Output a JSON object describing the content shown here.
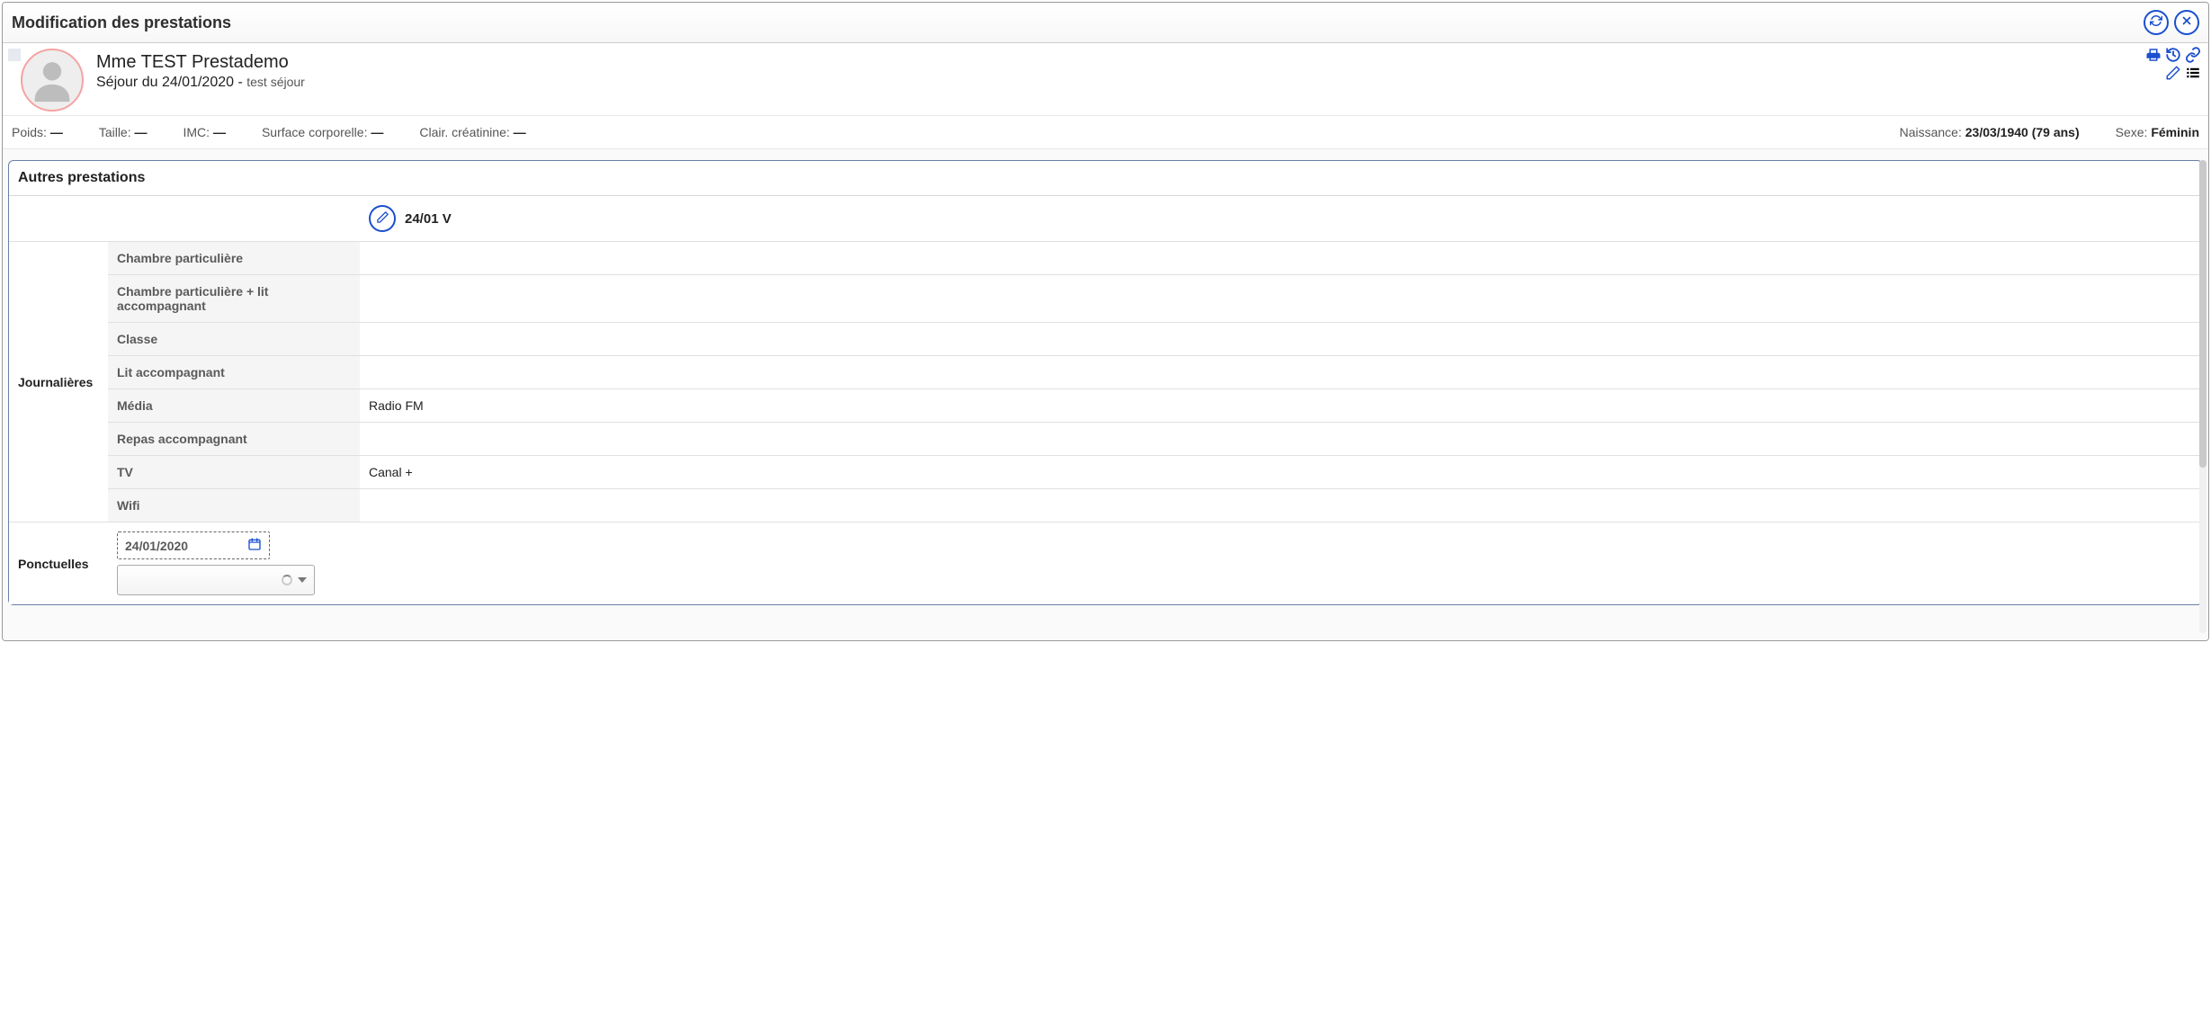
{
  "title": "Modification des prestations",
  "patient": {
    "name": "Mme TEST Prestademo",
    "stay_prefix": "Séjour du 24/01/2020 -",
    "stay_type": "test séjour"
  },
  "vitals": {
    "weight_label": "Poids:",
    "weight_value": "—",
    "height_label": "Taille:",
    "height_value": "—",
    "bmi_label": "IMC:",
    "bmi_value": "—",
    "bsa_label": "Surface corporelle:",
    "bsa_value": "—",
    "creat_label": "Clair. créatinine:",
    "creat_value": "—",
    "birth_label": "Naissance:",
    "birth_value": "23/03/1940 (79 ans)",
    "sex_label": "Sexe:",
    "sex_value": "Féminin"
  },
  "panel": {
    "title": "Autres prestations",
    "date_header": "24/01 V",
    "groups": {
      "daily_label": "Journalières",
      "punctual_label": "Ponctuelles"
    },
    "daily_rows": [
      {
        "name": "Chambre particulière",
        "value": ""
      },
      {
        "name": "Chambre particulière + lit accompagnant",
        "value": ""
      },
      {
        "name": "Classe",
        "value": ""
      },
      {
        "name": "Lit accompagnant",
        "value": ""
      },
      {
        "name": "Média",
        "value": "Radio FM"
      },
      {
        "name": "Repas accompagnant",
        "value": ""
      },
      {
        "name": "TV",
        "value": "Canal +"
      },
      {
        "name": "Wifi",
        "value": ""
      }
    ],
    "punctual": {
      "date": "24/01/2020",
      "dropdown_value": ""
    }
  },
  "icons": {
    "refresh": "refresh-icon",
    "close": "close-icon",
    "print": "print-icon",
    "history": "history-icon",
    "link": "link-icon",
    "edit": "edit-icon",
    "list": "list-icon",
    "calendar": "calendar-icon"
  }
}
